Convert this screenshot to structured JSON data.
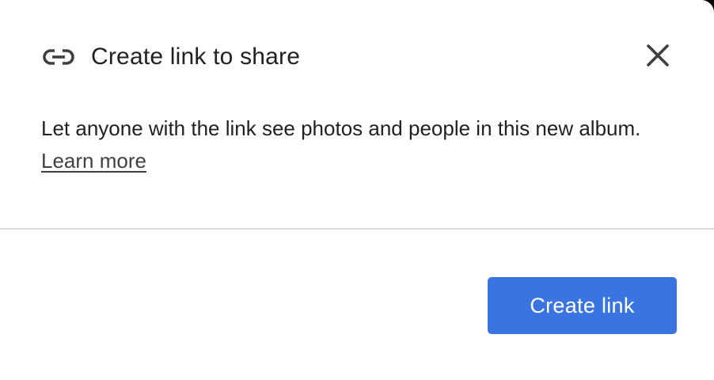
{
  "dialog": {
    "title": "Create link to share",
    "title_icon": "link-icon",
    "close_icon": "close-icon",
    "body_text": "Let anyone with the link see photos and people in this new album.",
    "learn_more_label": "Learn more",
    "primary_button_label": "Create link",
    "colors": {
      "primary_button": "#3a74e0",
      "text": "#202124",
      "divider": "#dadce0"
    }
  }
}
